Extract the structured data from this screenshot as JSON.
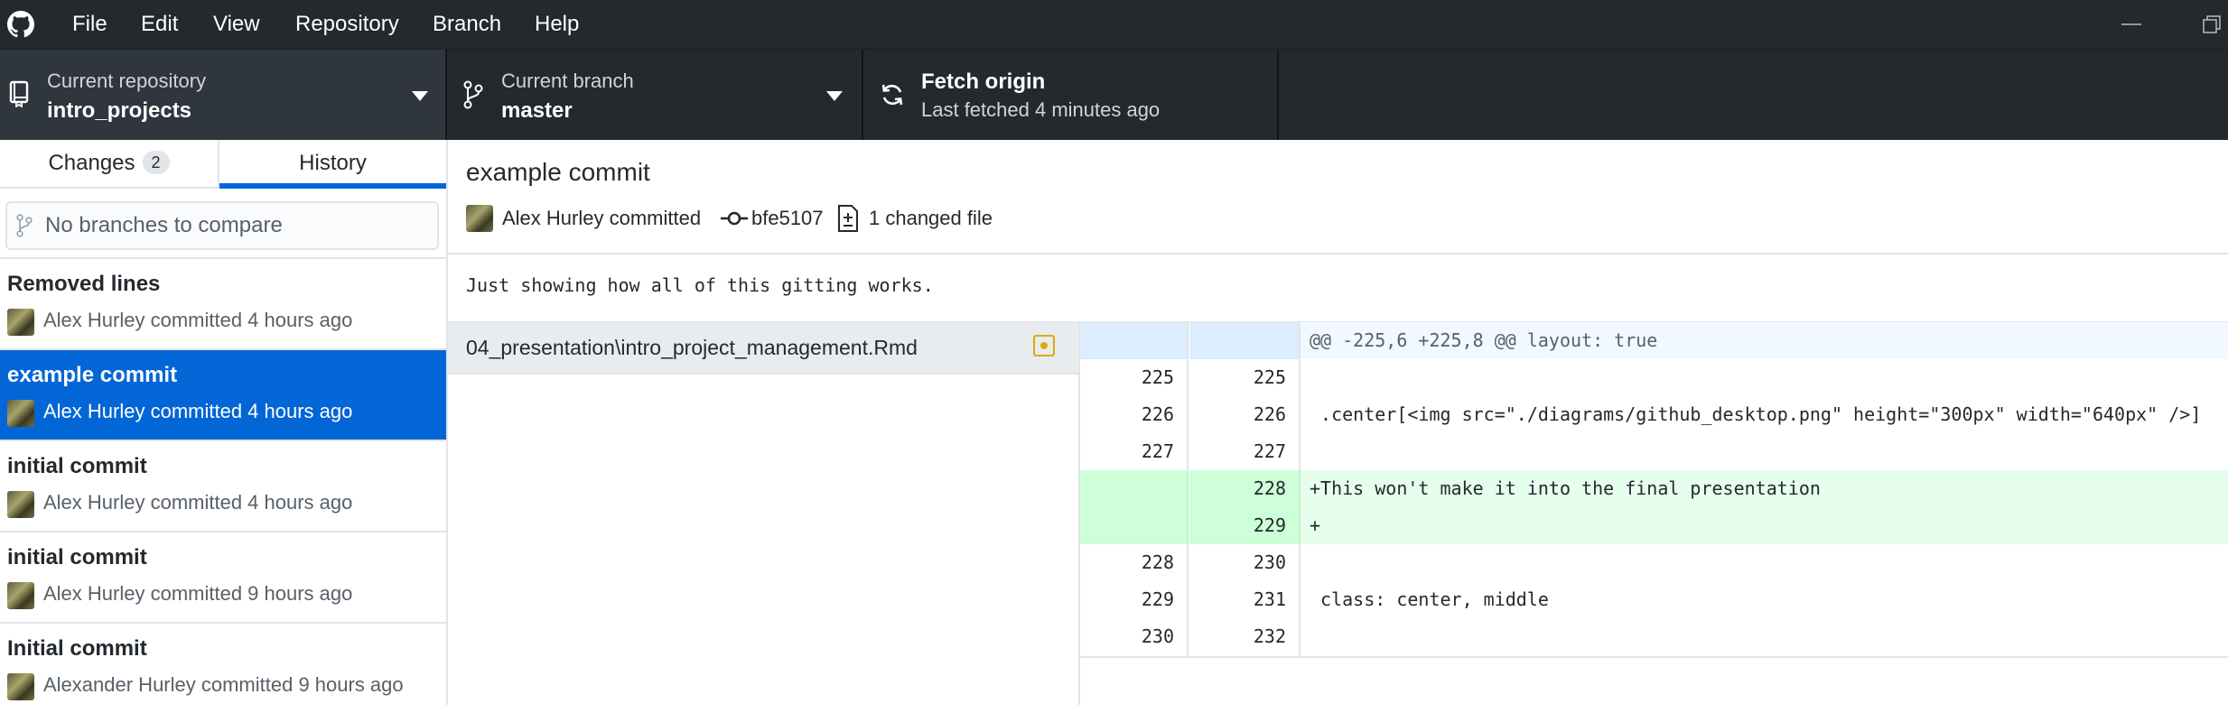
{
  "menu": {
    "items": [
      "File",
      "Edit",
      "View",
      "Repository",
      "Branch",
      "Help"
    ]
  },
  "toolbar": {
    "repo_label": "Current repository",
    "repo_value": "intro_projects",
    "branch_label": "Current branch",
    "branch_value": "master",
    "fetch_title": "Fetch origin",
    "fetch_subtitle": "Last fetched 4 minutes ago"
  },
  "sidebar": {
    "tabs": {
      "changes_label": "Changes",
      "changes_count": "2",
      "history_label": "History"
    },
    "compare_placeholder": "No branches to compare",
    "commits": [
      {
        "title": "Removed lines",
        "meta": "Alex Hurley committed 4 hours ago"
      },
      {
        "title": "example commit",
        "meta": "Alex Hurley committed 4 hours ago"
      },
      {
        "title": "initial commit",
        "meta": "Alex Hurley committed 4 hours ago"
      },
      {
        "title": "initial commit",
        "meta": "Alex Hurley committed 9 hours ago"
      },
      {
        "title": "Initial commit",
        "meta": "Alexander Hurley committed 9 hours ago"
      }
    ]
  },
  "commit": {
    "title": "example commit",
    "author_text": "Alex Hurley committed",
    "sha": "bfe5107",
    "changed_files": "1 changed file",
    "description": "Just showing how all of this gitting works."
  },
  "file": {
    "name": "04_presentation\\intro_project_management.Rmd",
    "status": "modified"
  },
  "diff": {
    "hunk": "@@ -225,6 +225,8 @@ layout: true",
    "lines": [
      {
        "old": "225",
        "new": "225",
        "text": ""
      },
      {
        "old": "226",
        "new": "226",
        "text": " .center[<img src=\"./diagrams/github_desktop.png\" height=\"300px\" width=\"640px\" />]"
      },
      {
        "old": "227",
        "new": "227",
        "text": ""
      },
      {
        "old": "",
        "new": "228",
        "text": "+This won't make it into the final presentation"
      },
      {
        "old": "",
        "new": "229",
        "text": "+"
      },
      {
        "old": "228",
        "new": "230",
        "text": ""
      },
      {
        "old": "229",
        "new": "231",
        "text": " class: center, middle"
      },
      {
        "old": "230",
        "new": "232",
        "text": ""
      }
    ]
  },
  "colors": {
    "titlebar": "#24292e",
    "accent": "#0366d6",
    "added_bg": "#e6ffed",
    "modified_icon": "#dbab09"
  }
}
